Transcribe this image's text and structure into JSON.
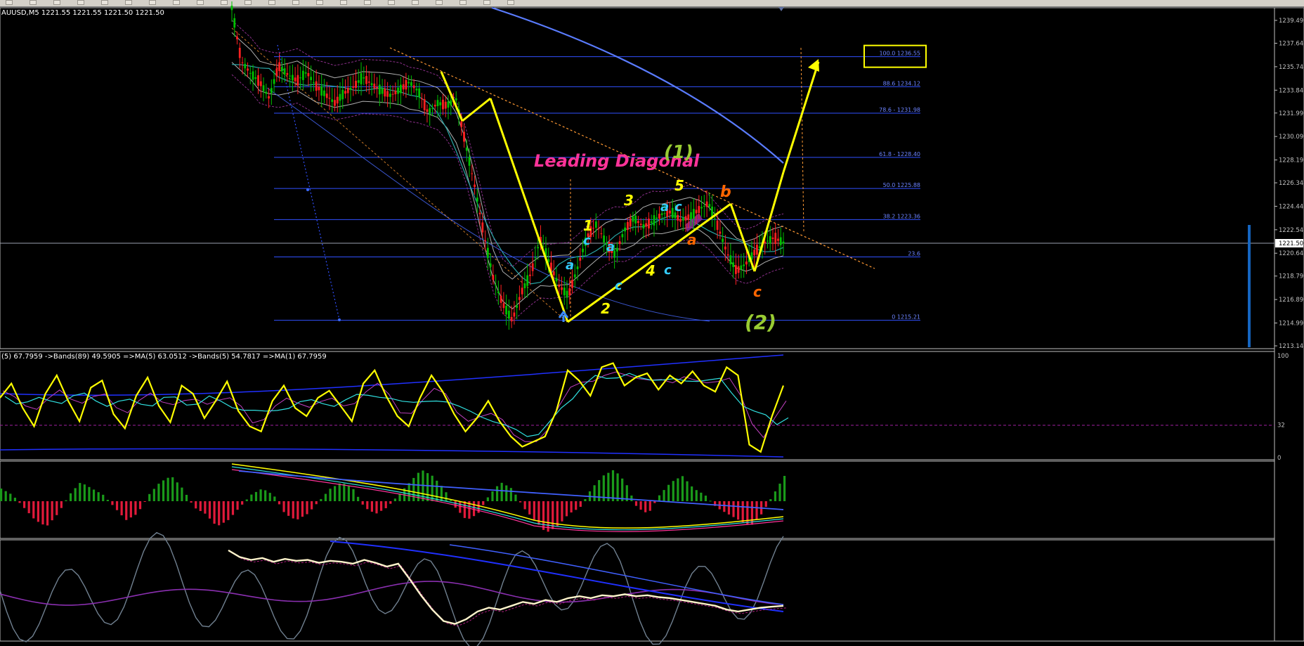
{
  "symbol_header": "AUUSD,M5  1221.55 1221.55 1221.50 1221.50",
  "osc_header": "(5) 67.7959  ->Bands(89) 49.5905  =>MA(5) 63.0512  ->Bands(5) 54.7817  =>MA(1) 67.7959",
  "toolbar": {
    "button_count": 22
  },
  "colors": {
    "background": "#000000",
    "axis_grey": "#c0c0c0",
    "fib_line": "#3050ff",
    "bull_candle": "#00c000",
    "bear_candle": "#ff2020",
    "wave_yellow": "#ffff00",
    "label_pink": "#ff3399",
    "label_green": "#99cc33",
    "label_cyan": "#33ccff",
    "label_orange": "#ff6600",
    "current_price_box": "#1565c0"
  },
  "chart_data": [
    {
      "type": "candlestick",
      "title": "AUUSD,M5",
      "ylim": [
        1213.14,
        1239.49
      ],
      "y_ticks": [
        "1239.49",
        "1237.64",
        "1235.74",
        "1233.84",
        "1231.99",
        "1230.09",
        "1228.19",
        "1226.34",
        "1224.44",
        "1222.54",
        "1220.64",
        "1218.79",
        "1216.89",
        "1214.99",
        "1213.14"
      ],
      "current_price": "1221.50",
      "price_path": [
        1240.5,
        1236.2,
        1235.2,
        1234.5,
        1233.2,
        1235.8,
        1235.1,
        1234.6,
        1235.3,
        1234.2,
        1233.5,
        1232.8,
        1233.6,
        1234.1,
        1234.9,
        1234.3,
        1233.8,
        1233.4,
        1233.9,
        1234.5,
        1233.7,
        1232.0,
        1232.8,
        1232.6,
        1233.1,
        1229.5,
        1226.0,
        1222.0,
        1218.5,
        1216.5,
        1215.2,
        1217.5,
        1219.0,
        1221.8,
        1219.8,
        1218.0,
        1217.2,
        1219.5,
        1222.0,
        1223.0,
        1221.5,
        1220.5,
        1222.5,
        1223.5,
        1222.8,
        1223.2,
        1223.8,
        1224.0,
        1223.3,
        1223.6,
        1224.2,
        1224.7,
        1222.8,
        1220.6,
        1219.2,
        1219.8,
        1220.8,
        1221.5,
        1221.9,
        1221.5
      ],
      "fib_levels": [
        {
          "label": "100.0 1236.55",
          "value": 1236.55
        },
        {
          "label": "88.6 1234.12",
          "value": 1234.12
        },
        {
          "label": "78.6 - 1231.98",
          "value": 1231.98
        },
        {
          "label": "61.8 - 1228.40",
          "value": 1228.4
        },
        {
          "label": "50.0 1225.88",
          "value": 1225.88
        },
        {
          "label": "38.2 1223.36",
          "value": 1223.36
        },
        {
          "label": "23.6",
          "value": 1220.34
        },
        {
          "label": "0 1215.21",
          "value": 1215.21
        }
      ],
      "annotations": {
        "title_text": "Leading Diagonal",
        "wave_1": "(1)",
        "wave_2": "(2)",
        "impulse": [
          "1",
          "2",
          "3",
          "4",
          "5"
        ],
        "sub_a": "a",
        "sub_b": "b",
        "sub_c": "c"
      }
    },
    {
      "type": "line",
      "name": "oscillator",
      "ylim": [
        0,
        100
      ],
      "y_ticks": [
        "100",
        "32",
        "0"
      ],
      "series": [
        {
          "color": "#ffff00",
          "values": [
            58,
            72,
            48,
            30,
            62,
            80,
            55,
            35,
            68,
            75,
            42,
            28,
            60,
            78,
            50,
            34,
            70,
            62,
            38,
            55,
            74,
            45,
            30,
            25,
            55,
            70,
            48,
            40,
            58,
            65,
            50,
            35,
            72,
            85,
            60,
            40,
            30,
            58,
            80,
            64,
            42,
            25,
            38,
            55,
            35,
            20,
            10,
            15,
            20,
            45,
            85,
            75,
            60,
            88,
            92,
            70,
            78,
            82,
            66,
            80,
            72,
            84,
            70,
            64,
            88,
            80,
            12,
            5,
            40,
            70
          ]
        }
      ]
    },
    {
      "type": "bar",
      "name": "histogram",
      "series": [
        {
          "values": [
            2,
            1,
            -1,
            -3,
            -4,
            -2,
            1,
            3,
            2,
            1,
            -1,
            -3,
            -2,
            1,
            3,
            4,
            2,
            -1,
            -2,
            -4,
            -3,
            -1,
            1,
            2,
            1,
            -2,
            -3,
            -2,
            0,
            2,
            3,
            2,
            -1,
            -2,
            -1,
            1,
            3,
            5,
            4,
            2,
            -1,
            -3,
            -2,
            1,
            3,
            2,
            -1,
            -3,
            -5,
            -4,
            -2,
            -1,
            2,
            4,
            5,
            3,
            -1,
            -2,
            1,
            3,
            4,
            2,
            1,
            -1,
            -2,
            -3,
            -4,
            -2,
            1,
            4
          ]
        }
      ]
    },
    {
      "type": "line",
      "name": "oscillator_2",
      "series": [
        {
          "color": "#fff5cc",
          "values": [
            92,
            85,
            82,
            84,
            80,
            83,
            81,
            82,
            79,
            81,
            80,
            78,
            82,
            79,
            75,
            78,
            62,
            45,
            30,
            18,
            15,
            20,
            28,
            32,
            30,
            34,
            38,
            36,
            40,
            38,
            42,
            44,
            42,
            45,
            44,
            46,
            44,
            45,
            43,
            42,
            40,
            38,
            36,
            34,
            30,
            28,
            30,
            32,
            33,
            34
          ]
        }
      ]
    }
  ]
}
